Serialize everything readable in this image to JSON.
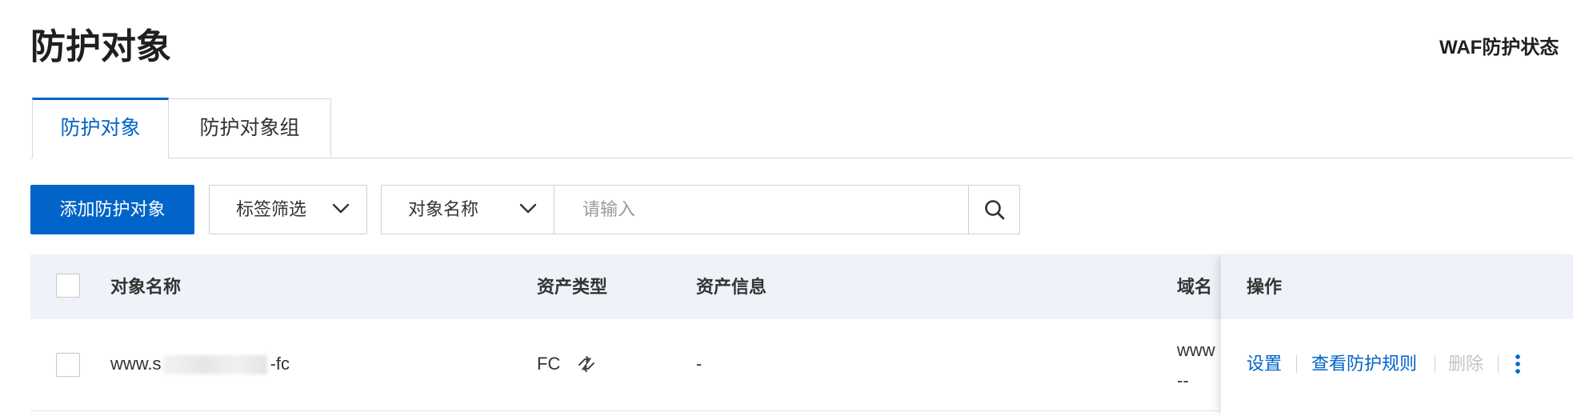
{
  "page": {
    "title": "防护对象",
    "waf_status_label": "WAF防护状态"
  },
  "tabs": [
    {
      "label": "防护对象",
      "active": true
    },
    {
      "label": "防护对象组",
      "active": false
    }
  ],
  "toolbar": {
    "add_button": "添加防护对象",
    "tag_filter": "标签筛选",
    "search_field": "对象名称",
    "search_placeholder": "请输入"
  },
  "table": {
    "columns": {
      "name": "对象名称",
      "asset_type": "资产类型",
      "asset_info": "资产信息",
      "domain": "域名",
      "actions": "操作"
    },
    "rows": [
      {
        "name_prefix": "www.s",
        "name_suffix": "-fc",
        "asset_type": "FC",
        "asset_info": "-",
        "domain_line1": "www",
        "domain_line2": "--",
        "actions": {
          "settings": "设置",
          "view_rules": "查看防护规则",
          "delete": "删除"
        }
      }
    ]
  },
  "icons": {
    "dropdown": "chevron-down-icon",
    "search": "search-icon",
    "asset_type": "link-icon",
    "more": "more-vertical-icon"
  },
  "colors": {
    "primary": "#0064c8",
    "table_header_bg": "#eff2f9",
    "disabled_text": "#c4c4c4",
    "border": "#cfcfcf"
  }
}
